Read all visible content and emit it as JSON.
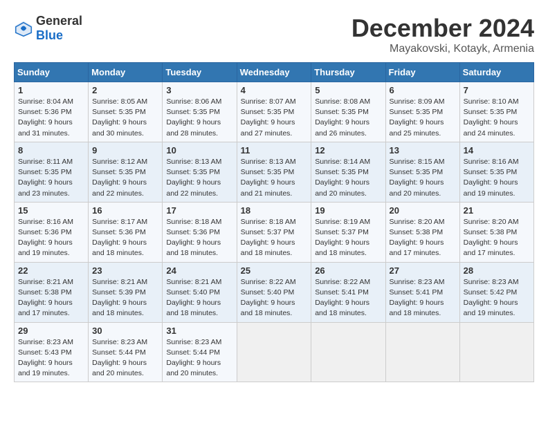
{
  "header": {
    "logo_general": "General",
    "logo_blue": "Blue",
    "month": "December 2024",
    "location": "Mayakovski, Kotayk, Armenia"
  },
  "columns": [
    "Sunday",
    "Monday",
    "Tuesday",
    "Wednesday",
    "Thursday",
    "Friday",
    "Saturday"
  ],
  "weeks": [
    [
      {
        "day": "1",
        "sunrise": "Sunrise: 8:04 AM",
        "sunset": "Sunset: 5:36 PM",
        "daylight": "Daylight: 9 hours and 31 minutes."
      },
      {
        "day": "2",
        "sunrise": "Sunrise: 8:05 AM",
        "sunset": "Sunset: 5:35 PM",
        "daylight": "Daylight: 9 hours and 30 minutes."
      },
      {
        "day": "3",
        "sunrise": "Sunrise: 8:06 AM",
        "sunset": "Sunset: 5:35 PM",
        "daylight": "Daylight: 9 hours and 28 minutes."
      },
      {
        "day": "4",
        "sunrise": "Sunrise: 8:07 AM",
        "sunset": "Sunset: 5:35 PM",
        "daylight": "Daylight: 9 hours and 27 minutes."
      },
      {
        "day": "5",
        "sunrise": "Sunrise: 8:08 AM",
        "sunset": "Sunset: 5:35 PM",
        "daylight": "Daylight: 9 hours and 26 minutes."
      },
      {
        "day": "6",
        "sunrise": "Sunrise: 8:09 AM",
        "sunset": "Sunset: 5:35 PM",
        "daylight": "Daylight: 9 hours and 25 minutes."
      },
      {
        "day": "7",
        "sunrise": "Sunrise: 8:10 AM",
        "sunset": "Sunset: 5:35 PM",
        "daylight": "Daylight: 9 hours and 24 minutes."
      }
    ],
    [
      {
        "day": "8",
        "sunrise": "Sunrise: 8:11 AM",
        "sunset": "Sunset: 5:35 PM",
        "daylight": "Daylight: 9 hours and 23 minutes."
      },
      {
        "day": "9",
        "sunrise": "Sunrise: 8:12 AM",
        "sunset": "Sunset: 5:35 PM",
        "daylight": "Daylight: 9 hours and 22 minutes."
      },
      {
        "day": "10",
        "sunrise": "Sunrise: 8:13 AM",
        "sunset": "Sunset: 5:35 PM",
        "daylight": "Daylight: 9 hours and 22 minutes."
      },
      {
        "day": "11",
        "sunrise": "Sunrise: 8:13 AM",
        "sunset": "Sunset: 5:35 PM",
        "daylight": "Daylight: 9 hours and 21 minutes."
      },
      {
        "day": "12",
        "sunrise": "Sunrise: 8:14 AM",
        "sunset": "Sunset: 5:35 PM",
        "daylight": "Daylight: 9 hours and 20 minutes."
      },
      {
        "day": "13",
        "sunrise": "Sunrise: 8:15 AM",
        "sunset": "Sunset: 5:35 PM",
        "daylight": "Daylight: 9 hours and 20 minutes."
      },
      {
        "day": "14",
        "sunrise": "Sunrise: 8:16 AM",
        "sunset": "Sunset: 5:35 PM",
        "daylight": "Daylight: 9 hours and 19 minutes."
      }
    ],
    [
      {
        "day": "15",
        "sunrise": "Sunrise: 8:16 AM",
        "sunset": "Sunset: 5:36 PM",
        "daylight": "Daylight: 9 hours and 19 minutes."
      },
      {
        "day": "16",
        "sunrise": "Sunrise: 8:17 AM",
        "sunset": "Sunset: 5:36 PM",
        "daylight": "Daylight: 9 hours and 18 minutes."
      },
      {
        "day": "17",
        "sunrise": "Sunrise: 8:18 AM",
        "sunset": "Sunset: 5:36 PM",
        "daylight": "Daylight: 9 hours and 18 minutes."
      },
      {
        "day": "18",
        "sunrise": "Sunrise: 8:18 AM",
        "sunset": "Sunset: 5:37 PM",
        "daylight": "Daylight: 9 hours and 18 minutes."
      },
      {
        "day": "19",
        "sunrise": "Sunrise: 8:19 AM",
        "sunset": "Sunset: 5:37 PM",
        "daylight": "Daylight: 9 hours and 18 minutes."
      },
      {
        "day": "20",
        "sunrise": "Sunrise: 8:20 AM",
        "sunset": "Sunset: 5:38 PM",
        "daylight": "Daylight: 9 hours and 17 minutes."
      },
      {
        "day": "21",
        "sunrise": "Sunrise: 8:20 AM",
        "sunset": "Sunset: 5:38 PM",
        "daylight": "Daylight: 9 hours and 17 minutes."
      }
    ],
    [
      {
        "day": "22",
        "sunrise": "Sunrise: 8:21 AM",
        "sunset": "Sunset: 5:38 PM",
        "daylight": "Daylight: 9 hours and 17 minutes."
      },
      {
        "day": "23",
        "sunrise": "Sunrise: 8:21 AM",
        "sunset": "Sunset: 5:39 PM",
        "daylight": "Daylight: 9 hours and 18 minutes."
      },
      {
        "day": "24",
        "sunrise": "Sunrise: 8:21 AM",
        "sunset": "Sunset: 5:40 PM",
        "daylight": "Daylight: 9 hours and 18 minutes."
      },
      {
        "day": "25",
        "sunrise": "Sunrise: 8:22 AM",
        "sunset": "Sunset: 5:40 PM",
        "daylight": "Daylight: 9 hours and 18 minutes."
      },
      {
        "day": "26",
        "sunrise": "Sunrise: 8:22 AM",
        "sunset": "Sunset: 5:41 PM",
        "daylight": "Daylight: 9 hours and 18 minutes."
      },
      {
        "day": "27",
        "sunrise": "Sunrise: 8:23 AM",
        "sunset": "Sunset: 5:41 PM",
        "daylight": "Daylight: 9 hours and 18 minutes."
      },
      {
        "day": "28",
        "sunrise": "Sunrise: 8:23 AM",
        "sunset": "Sunset: 5:42 PM",
        "daylight": "Daylight: 9 hours and 19 minutes."
      }
    ],
    [
      {
        "day": "29",
        "sunrise": "Sunrise: 8:23 AM",
        "sunset": "Sunset: 5:43 PM",
        "daylight": "Daylight: 9 hours and 19 minutes."
      },
      {
        "day": "30",
        "sunrise": "Sunrise: 8:23 AM",
        "sunset": "Sunset: 5:44 PM",
        "daylight": "Daylight: 9 hours and 20 minutes."
      },
      {
        "day": "31",
        "sunrise": "Sunrise: 8:23 AM",
        "sunset": "Sunset: 5:44 PM",
        "daylight": "Daylight: 9 hours and 20 minutes."
      },
      null,
      null,
      null,
      null
    ]
  ]
}
